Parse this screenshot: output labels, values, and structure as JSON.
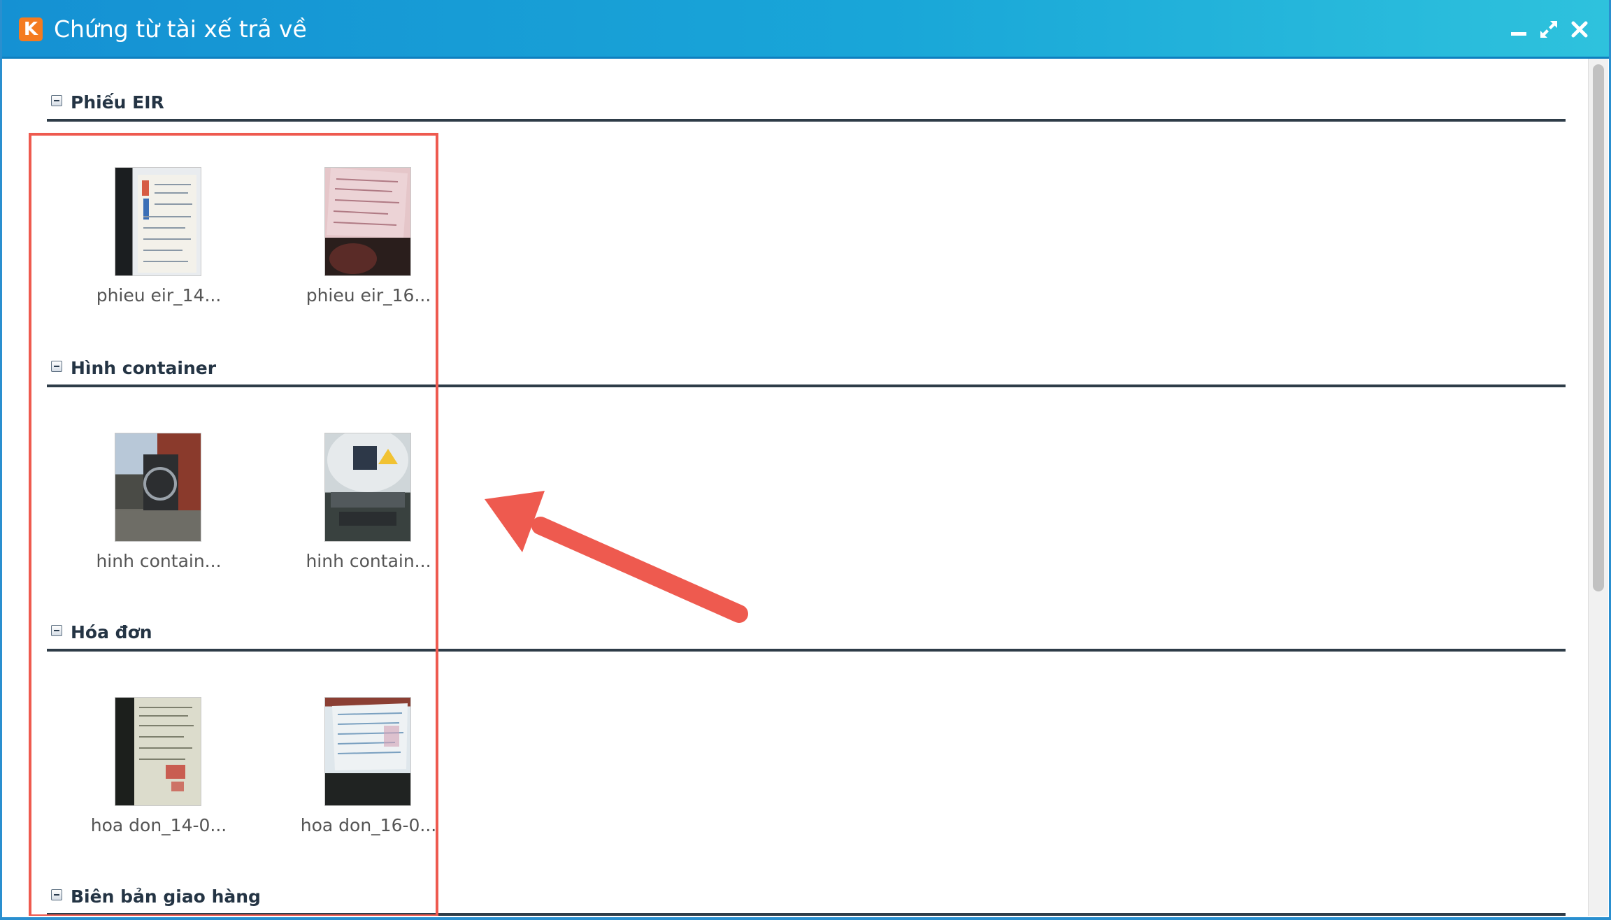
{
  "window": {
    "title": "Chứng từ tài xế trả về",
    "logo_letter": "K",
    "accent_color": "#1591d3",
    "controls": [
      {
        "name": "minimize-icon"
      },
      {
        "name": "maximize-icon"
      },
      {
        "name": "close-icon"
      }
    ]
  },
  "sections": [
    {
      "title": "Phiếu EIR",
      "items": [
        {
          "label": "phieu eir_14..."
        },
        {
          "label": "phieu eir_16..."
        }
      ]
    },
    {
      "title": "Hình container",
      "items": [
        {
          "label": "hinh contain..."
        },
        {
          "label": "hinh contain..."
        }
      ]
    },
    {
      "title": "Hóa đơn",
      "items": [
        {
          "label": "hoa don_14-0..."
        },
        {
          "label": "hoa don_16-0..."
        }
      ]
    },
    {
      "title": "Biên bản giao hàng",
      "items": []
    }
  ],
  "annotation": {
    "color": "#ee5a4f",
    "shapes": [
      "highlight-box",
      "pointer-arrow"
    ]
  }
}
